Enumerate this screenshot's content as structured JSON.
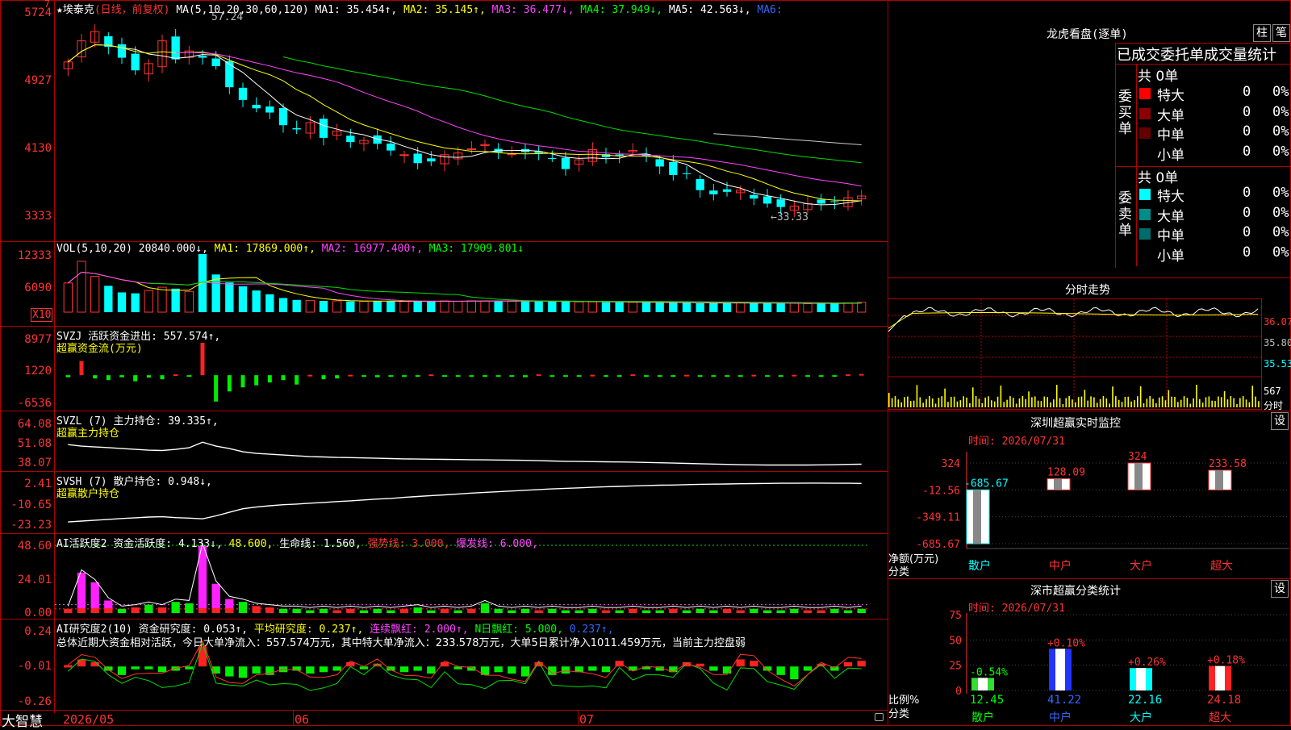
{
  "stock": {
    "name": "★埃泰克",
    "period": "(日线，前复权)",
    "ma_header": "MA(5,10,20,30,60,120)",
    "ma1": "MA1: 35.454↑,",
    "ma2": "MA2: 35.145↑,",
    "ma3": "MA3: 36.477↓,",
    "ma4": "MA4: 37.949↓,",
    "ma5": "MA5: 42.563↓,",
    "ma6": "MA6:",
    "high_marker": "57.24",
    "low_marker": "←33.33",
    "price_axis": [
      "5724",
      "4927",
      "4130",
      "3333"
    ]
  },
  "volume": {
    "header": "VOL(5,10,20)",
    "value": "20840.000↓,",
    "ma1": "MA1: 17869.000↑,",
    "ma2": "MA2: 16977.400↑,",
    "ma3": "MA3: 17909.801↓",
    "axis": [
      "12333",
      "6090"
    ],
    "unit": "X10"
  },
  "svzj": {
    "header": "SVZJ  活跃资金进出: 557.574↑,",
    "sub": "超赢资金流(万元)",
    "axis": [
      "8977",
      "1220",
      "-6536"
    ]
  },
  "svzl": {
    "header": "SVZL (7) 主力持仓: 39.335↑,",
    "sub": "超赢主力持仓",
    "axis": [
      "64.08",
      "51.08",
      "38.07"
    ]
  },
  "svsh": {
    "header": "SVSH (7) 散户持仓: 0.948↓,",
    "sub": "超赢散户持仓",
    "axis": [
      "2.41",
      "-10.65",
      "-23.23"
    ]
  },
  "ai1": {
    "header": "AI活跃度2 资金活跃度: 4.133↓,",
    "v2": "48.600,",
    "v3": "生命线: 1.560,",
    "v4": "强势线: 3.000,",
    "v5": "爆发线: 6.000,",
    "axis": [
      "48.60",
      "24.01",
      "0.00"
    ]
  },
  "ai2": {
    "header": "AI研究度2(10) 资金研究度: 0.053↑,",
    "v2": "平均研究度: 0.237↑,",
    "v3": "连续飘红: 2.000↑,",
    "v4": "N日飘红: 5.000,",
    "v5": "0.237↑,",
    "summary": "总体近期大资金相对活跃，今日大单净流入：557.574万元，其中特大单净流入：233.578万元，大单5日累计净入1011.459万元，当前主力控盘弱",
    "axis": [
      "0.24",
      "-0.01",
      "-0.26"
    ]
  },
  "bottom": {
    "brand": "大智慧",
    "date1": "2026/05",
    "date2": "06",
    "date3": "07",
    "corner": "7"
  },
  "dragon": {
    "title": "龙虎看盘(逐单)",
    "btn1": "柱",
    "btn2": "笔",
    "table_title": "已成交委托单成交量统计",
    "buy_label": "委买单",
    "sell_label": "委卖单",
    "buy_total": "共 0单",
    "sell_total": "共 0单",
    "buy_rows": [
      {
        "label": "特大",
        "count": "0",
        "pct": "0%",
        "color": "#ff0000"
      },
      {
        "label": "大单",
        "count": "0",
        "pct": "0%",
        "color": "#8b0000"
      },
      {
        "label": "中单",
        "count": "0",
        "pct": "0%",
        "color": "#660000"
      },
      {
        "label": "小单",
        "count": "0",
        "pct": "0%",
        "color": "#000000"
      }
    ],
    "sell_rows": [
      {
        "label": "特大",
        "count": "0",
        "pct": "0%",
        "color": "#00ffff"
      },
      {
        "label": "大单",
        "count": "0",
        "pct": "0%",
        "color": "#008b8b"
      },
      {
        "label": "中单",
        "count": "0",
        "pct": "0%",
        "color": "#006b6b"
      },
      {
        "label": "小单",
        "count": "0",
        "pct": "0%",
        "color": "#000000"
      }
    ]
  },
  "intraday": {
    "title": "分时走势",
    "axis": [
      "36.07",
      "35.80",
      "35.53"
    ],
    "vol_axis": "567",
    "vol_label": "分时"
  },
  "monitor": {
    "title": "深圳超赢实时监控",
    "btn": "设",
    "date": "时间: 2026/07/31",
    "axis": [
      "324",
      "-12.56",
      "-349.11",
      "-685.67"
    ],
    "left_label1": "净额(万元)",
    "left_label2": "分类",
    "bars": [
      {
        "cat": "散户",
        "value": -685.67,
        "label": "-685.67"
      },
      {
        "cat": "中户",
        "value": 128.09,
        "label": "128.09"
      },
      {
        "cat": "大户",
        "value": 324,
        "label": "324"
      },
      {
        "cat": "超大",
        "value": 233.58,
        "label": "233.58"
      }
    ]
  },
  "stats": {
    "title": "深市超赢分类统计",
    "btn": "设",
    "date": "时间: 2026/07/31",
    "axis": [
      "75",
      "50",
      "25",
      "0"
    ],
    "left_label1": "比例%",
    "left_label2": "分类",
    "bars": [
      {
        "cat": "散户",
        "value": 12.45,
        "label": "12.45",
        "change": "-0.54%"
      },
      {
        "cat": "中户",
        "value": 41.22,
        "label": "41.22",
        "change": "+0.10%"
      },
      {
        "cat": "大户",
        "value": 22.16,
        "label": "22.16",
        "change": "+0.26%"
      },
      {
        "cat": "超大",
        "value": 24.18,
        "label": "24.18",
        "change": "+0.18%"
      }
    ]
  },
  "chart_data": [
    {
      "type": "candlestick",
      "title": "★埃泰克",
      "ylim": [
        33.33,
        57.24
      ],
      "note": "daily K-line with moving averages; values approximate",
      "closes": [
        52.0,
        54.5,
        55.6,
        53.8,
        52.5,
        51.0,
        51.8,
        54.5,
        52.3,
        53.3,
        52.5,
        51.5,
        49.0,
        47.5,
        46.5,
        46.0,
        44.5,
        44.0,
        44.8,
        43.0,
        43.8,
        42.5,
        42.7,
        42.3,
        41.5,
        41.0,
        40.0,
        40.2,
        41.0,
        41.2,
        41.7,
        42.2,
        41.3,
        41.1,
        41.3,
        41.2,
        40.6,
        39.3,
        40.4,
        41.6,
        40.7,
        40.9,
        41.5,
        40.8,
        39.6,
        38.6,
        38.7,
        36.8,
        36.3,
        36.6,
        36.8,
        35.8,
        35.2,
        34.8,
        34.9,
        35.2,
        35.2,
        35.4,
        35.9,
        36.1
      ]
    },
    {
      "type": "bar",
      "title": "VOL(5,10,20)",
      "ylim": [
        0,
        12333
      ],
      "note": "volume (X10), approximate",
      "values": [
        6200,
        10800,
        7600,
        5600,
        4200,
        4000,
        4600,
        5300,
        5000,
        4400,
        12333,
        8000,
        6300,
        5500,
        4600,
        3800,
        3000,
        2600,
        2500,
        2400,
        2400,
        2300,
        2300,
        2400,
        2300,
        2300,
        2300,
        2300,
        2400,
        2300,
        2400,
        2400,
        2400,
        2300,
        2300,
        2300,
        2300,
        2300,
        2200,
        2200,
        2100,
        2100,
        2100,
        2100,
        2000,
        2000,
        2000,
        1900,
        1900,
        2000,
        2000,
        1900,
        1900,
        1900,
        1900,
        1800,
        1800,
        1900,
        2000,
        2100
      ]
    },
    {
      "type": "bar",
      "title": "SVZJ",
      "ylim": [
        -6536,
        8977
      ],
      "values": [
        -500,
        3500,
        -800,
        -1200,
        -500,
        -1500,
        -600,
        -1000,
        200,
        -400,
        8000,
        -6500,
        -4000,
        -3000,
        -2500,
        -1800,
        -1200,
        -2300,
        100,
        -1000,
        -800,
        100,
        -300,
        -500,
        -300,
        -400,
        -300,
        200,
        -300,
        -400,
        -300,
        -300,
        -300,
        -400,
        -500,
        200,
        -300,
        -300,
        -300,
        100,
        -300,
        -300,
        200,
        -300,
        -300,
        -300,
        100,
        -300,
        -300,
        -300,
        -300,
        100,
        -300,
        -300,
        100,
        -300,
        -300,
        -300,
        200,
        300
      ]
    },
    {
      "type": "line",
      "title": "SVZL",
      "ylim": [
        38.07,
        64.08
      ],
      "series": [
        {
          "name": "主力持仓",
          "values": [
            51.5,
            50.5,
            50.0,
            49.6,
            49.0,
            48.5,
            48.0,
            47.8,
            48.5,
            49.5,
            53.0,
            50.5,
            49.0,
            47.0,
            46.0,
            45.5,
            45.0,
            44.5,
            44.0,
            43.8,
            43.5,
            43.4,
            43.2,
            43.0,
            42.8,
            42.6,
            42.5,
            42.4,
            42.3,
            42.2,
            42.1,
            42.0,
            41.9,
            41.8,
            41.7,
            41.5,
            41.3,
            41.1,
            41.0,
            40.9,
            40.8,
            40.7,
            40.6,
            40.4,
            40.2,
            40.0,
            39.8,
            39.6,
            39.4,
            39.2,
            39.0,
            38.9,
            38.8,
            38.8,
            38.8,
            38.8,
            38.9,
            39.0,
            39.2,
            39.3
          ]
        }
      ]
    },
    {
      "type": "line",
      "title": "SVSH",
      "ylim": [
        -23.23,
        2.41
      ],
      "series": [
        {
          "name": "散户持仓",
          "values": [
            -21.0,
            -20.5,
            -20.0,
            -19.5,
            -19.0,
            -18.6,
            -18.2,
            -18.0,
            -18.5,
            -18.8,
            -19.2,
            -17.5,
            -15.5,
            -13.5,
            -12.5,
            -11.8,
            -11.2,
            -10.8,
            -10.3,
            -9.9,
            -9.4,
            -9.0,
            -8.5,
            -8.0,
            -7.6,
            -7.0,
            -6.5,
            -6.0,
            -5.6,
            -5.1,
            -4.6,
            -4.2,
            -3.8,
            -3.4,
            -3.0,
            -2.6,
            -2.2,
            -1.9,
            -1.6,
            -1.3,
            -1.0,
            -0.8,
            -0.5,
            -0.3,
            -0.1,
            0.0,
            0.2,
            0.4,
            0.5,
            0.6,
            0.7,
            0.8,
            0.9,
            1.0,
            1.0,
            1.1,
            1.1,
            1.0,
            1.0,
            0.9
          ]
        }
      ]
    },
    {
      "type": "bar",
      "title": "AI活跃度2",
      "ylim": [
        0,
        48.6
      ],
      "values": [
        3,
        29,
        22,
        9,
        3,
        4,
        6,
        4,
        8,
        7,
        48,
        21,
        10,
        8,
        5,
        4,
        3,
        3,
        2,
        3,
        2,
        3,
        2,
        3,
        2,
        3,
        4,
        2,
        3,
        2,
        3,
        7,
        3,
        2,
        3,
        2,
        3,
        2,
        2,
        3,
        2,
        2,
        3,
        2,
        2,
        3,
        2,
        3,
        2,
        3,
        2,
        3,
        2,
        2,
        3,
        2,
        2,
        3,
        2,
        3
      ]
    },
    {
      "type": "bar",
      "title": "AI研究度2(10)",
      "ylim": [
        -0.26,
        0.24
      ],
      "values": [
        0.01,
        0.05,
        0.03,
        -0.03,
        -0.06,
        -0.02,
        -0.02,
        -0.04,
        -0.03,
        -0.02,
        0.14,
        -0.05,
        -0.07,
        -0.08,
        -0.05,
        -0.06,
        -0.04,
        -0.03,
        -0.05,
        -0.04,
        -0.03,
        0.03,
        -0.02,
        0.02,
        -0.03,
        -0.04,
        -0.03,
        -0.05,
        0.03,
        -0.02,
        -0.03,
        -0.06,
        -0.04,
        -0.05,
        -0.07,
        0.03,
        -0.06,
        -0.05,
        -0.04,
        -0.03,
        -0.04,
        0.04,
        -0.03,
        -0.02,
        -0.03,
        -0.04,
        0.03,
        0.02,
        -0.03,
        -0.05,
        0.05,
        0.04,
        -0.03,
        -0.06,
        -0.09,
        -0.03,
        0.02,
        -0.03,
        0.03,
        0.04
      ]
    },
    {
      "type": "bar",
      "title": "深圳超赢实时监控",
      "categories": [
        "散户",
        "中户",
        "大户",
        "超大"
      ],
      "values": [
        -685.67,
        128.09,
        324,
        233.58
      ],
      "ylim": [
        -685.67,
        324
      ]
    },
    {
      "type": "bar",
      "title": "深市超赢分类统计",
      "categories": [
        "散户",
        "中户",
        "大户",
        "超大"
      ],
      "values": [
        12.45,
        41.22,
        22.16,
        24.18
      ],
      "ylim": [
        0,
        75
      ]
    }
  ]
}
